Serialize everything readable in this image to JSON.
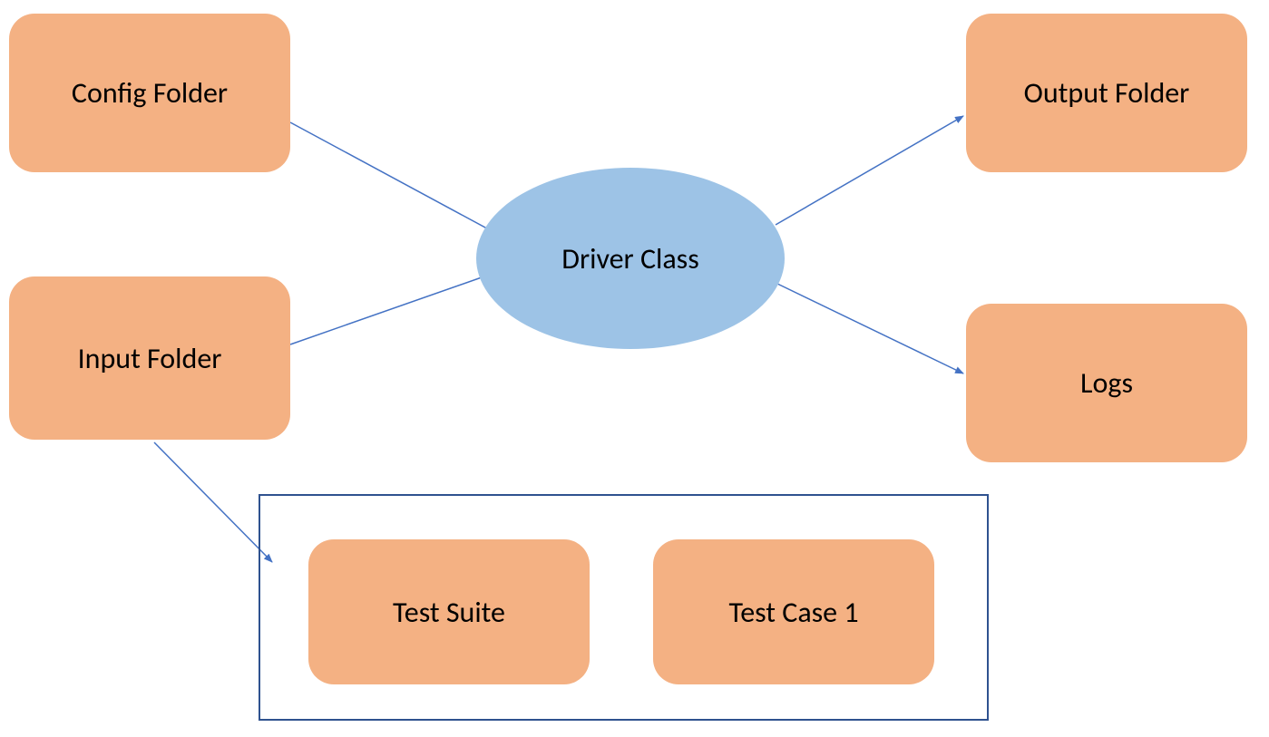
{
  "nodes": {
    "config_folder": {
      "label": "Config Folder"
    },
    "input_folder": {
      "label": "Input Folder"
    },
    "driver_class": {
      "label": "Driver Class"
    },
    "output_folder": {
      "label": "Output Folder"
    },
    "logs": {
      "label": "Logs"
    },
    "test_suite": {
      "label": "Test Suite"
    },
    "test_case_1": {
      "label": "Test Case 1"
    }
  },
  "colors": {
    "rect_fill": "#F4B183",
    "ellipse_fill": "#9DC3E6",
    "arrow_stroke": "#4472C4",
    "container_border": "#2F528F"
  },
  "diagram": {
    "description": "Flow diagram: Config Folder and Input Folder feed into Driver Class (ellipse). Driver Class outputs to Output Folder and Logs. Input Folder also points to a container holding Test Suite and Test Case 1.",
    "edges": [
      {
        "from": "config_folder",
        "to": "driver_class"
      },
      {
        "from": "input_folder",
        "to": "driver_class"
      },
      {
        "from": "driver_class",
        "to": "output_folder"
      },
      {
        "from": "driver_class",
        "to": "logs"
      },
      {
        "from": "input_folder",
        "to": "container"
      }
    ]
  }
}
